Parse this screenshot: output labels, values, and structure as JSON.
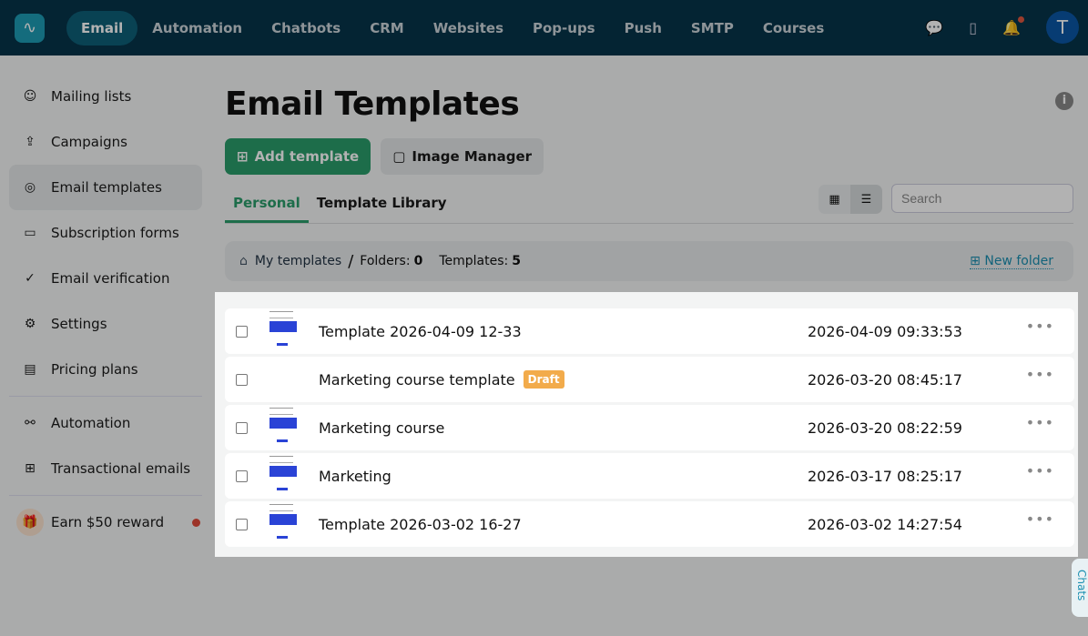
{
  "topnav": {
    "items": [
      "Email",
      "Automation",
      "Chatbots",
      "CRM",
      "Websites",
      "Pop-ups",
      "Push",
      "SMTP",
      "Courses"
    ],
    "active": "Email",
    "avatar": "T"
  },
  "sidebar": {
    "items": [
      "Mailing lists",
      "Campaigns",
      "Email templates",
      "Subscription forms",
      "Email verification",
      "Settings",
      "Pricing plans"
    ],
    "items2": [
      "Automation",
      "Transactional emails"
    ],
    "reward": "Earn $50 reward"
  },
  "main": {
    "title": "Email Templates",
    "add_template": "Add template",
    "image_manager": "Image Manager",
    "tabs": [
      "Personal",
      "Template Library"
    ],
    "search_placeholder": "Search"
  },
  "breadcrumb": {
    "home": "My templates",
    "sep": "/",
    "folders_label": "Folders:",
    "folders": "0",
    "templates_label": "Templates:",
    "templates": "5",
    "new_folder": "New folder"
  },
  "templates": [
    {
      "name": "Template 2026-04-09 12-33",
      "date": "2026-04-09 09:33:53",
      "badge": ""
    },
    {
      "name": "Marketing course template",
      "date": "2026-03-20 08:45:17",
      "badge": "Draft"
    },
    {
      "name": "Marketing course",
      "date": "2026-03-20 08:22:59",
      "badge": ""
    },
    {
      "name": "Marketing",
      "date": "2026-03-17 08:25:17",
      "badge": ""
    },
    {
      "name": "Template 2026-03-02 16-27",
      "date": "2026-03-02 14:27:54",
      "badge": ""
    }
  ],
  "chats": "Chats"
}
